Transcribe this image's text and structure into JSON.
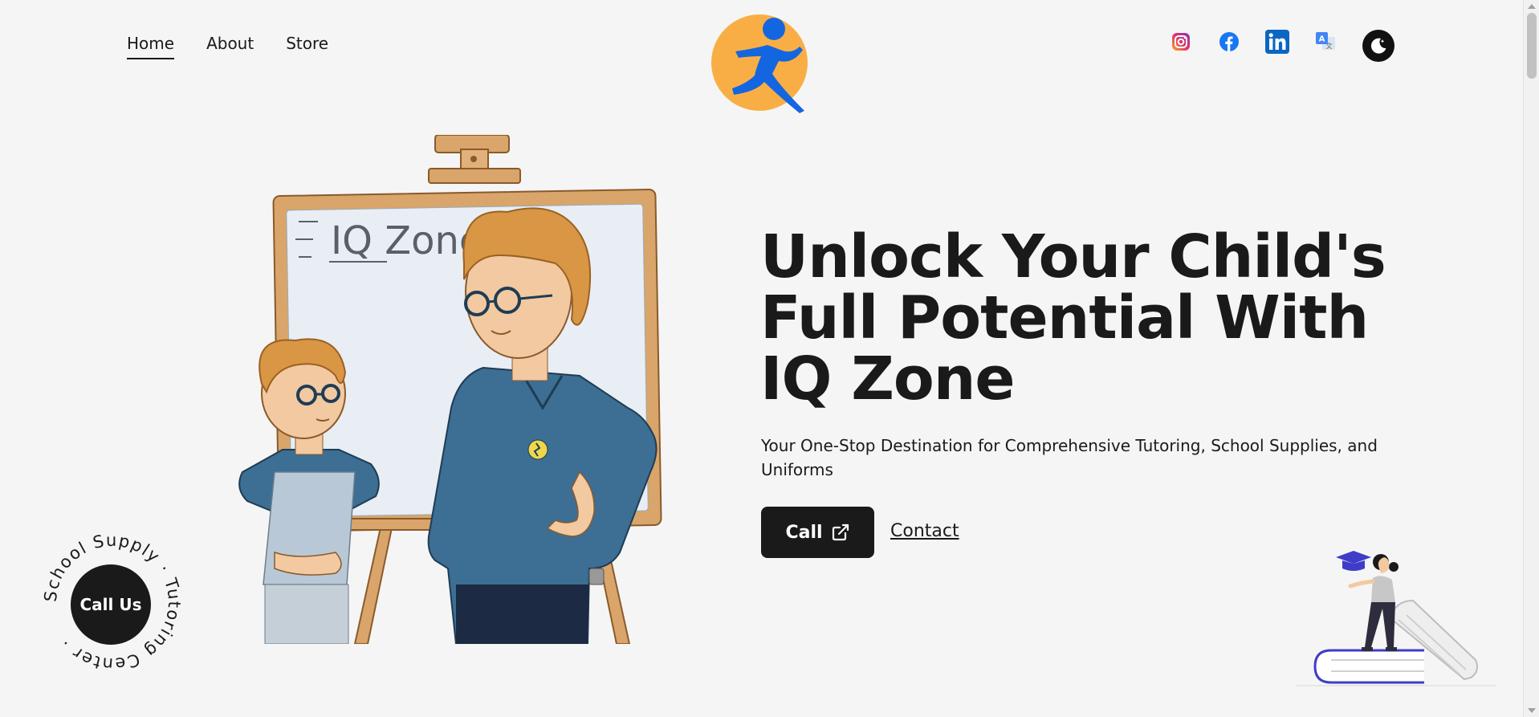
{
  "nav": {
    "items": [
      {
        "label": "Home",
        "active": true
      },
      {
        "label": "About",
        "active": false
      },
      {
        "label": "Store",
        "active": false
      }
    ]
  },
  "logo": {
    "icon": "running-figure-logo",
    "colors": {
      "circle": "#F9AE45",
      "figure": "#1466E0"
    }
  },
  "socials": [
    {
      "name": "instagram",
      "icon": "instagram-icon"
    },
    {
      "name": "facebook",
      "icon": "facebook-icon"
    },
    {
      "name": "linkedin",
      "icon": "linkedin-icon"
    },
    {
      "name": "translate",
      "icon": "translate-icon"
    }
  ],
  "theme_toggle": {
    "icon": "moon-icon"
  },
  "hero": {
    "title": "Unlock Your Child's Full Potential With IQ Zone",
    "subtitle": "Your One-Stop Destination for Comprehensive Tutoring, School Supplies, and Uniforms",
    "call_button": "Call",
    "contact_link": "Contact",
    "board_text": "IQ Zone"
  },
  "badge": {
    "ring_text": "School Supply · Tutoring Center ·",
    "button_label": "Call Us"
  },
  "colors": {
    "background": "#F5F5F5",
    "text": "#1A1A1A",
    "accent_blue": "#1466E0",
    "accent_orange": "#F9AE45"
  }
}
